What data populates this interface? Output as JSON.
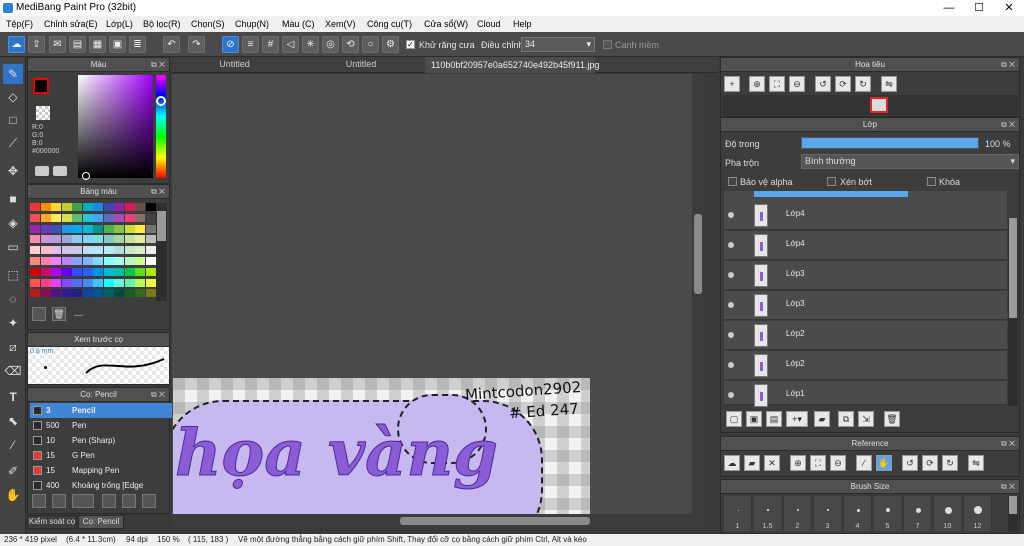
{
  "app": {
    "title": "MediBang Paint Pro (32bit)"
  },
  "menu": [
    "Tệp(F)",
    "Chỉnh sửa(E)",
    "Lớp(L)",
    "Bộ lọc(R)",
    "Chọn(S)",
    "Chụp(N)",
    "Màu (C)",
    "Xem(V)",
    "Công cụ(T)",
    "Cửa sổ(W)",
    "Cloud",
    "Help"
  ],
  "toolbar": {
    "antialias_label": "Khử răng cưa",
    "adjust_label": "Điều chỉnh",
    "adjust_value": "34",
    "edge_label": "Cạnh mềm"
  },
  "color_panel": {
    "title": "Màu",
    "r": "R:0",
    "g": "G:0",
    "b": "B:0",
    "hex": "#000000"
  },
  "palette_panel": {
    "title": "Bảng màu",
    "footer_text": "---"
  },
  "preview_panel": {
    "title": "Xem trước cọ",
    "size": "0.8 mm"
  },
  "brush_panel": {
    "title": "Cọ: Pencil",
    "items": [
      {
        "size": "3",
        "name": "Pencil",
        "color": "#2a2a2a"
      },
      {
        "size": "500",
        "name": "Pen",
        "color": "#2a2a2a"
      },
      {
        "size": "10",
        "name": "Pen (Sharp)",
        "color": "#2a2a2a"
      },
      {
        "size": "15",
        "name": "G Pen",
        "color": "#e53935"
      },
      {
        "size": "15",
        "name": "Mapping Pen",
        "color": "#e53935"
      },
      {
        "size": "400",
        "name": "Khoảng trống [Edge",
        "color": "#2a2a2a"
      }
    ]
  },
  "bottom_tabs": [
    "Kiểm soát cọ",
    "Cọ: Pencil"
  ],
  "doc_tabs": [
    "Untitled",
    "Untitled",
    "110b0bf20957e0a652740e492b45f911.jpg"
  ],
  "canvas": {
    "text1": "Mintcodon2902",
    "text2": "# Ed 247",
    "text3": "họa vàng"
  },
  "navigator": {
    "title": "Hoa tiêu"
  },
  "layer_panel": {
    "title": "Lớp",
    "opacity_label": "Độ trong",
    "opacity_value": "100 %",
    "opacity": 1.0,
    "blend_label": "Pha trộn",
    "blend_value": "Bình thường",
    "protect_alpha": "Bảo vệ alpha",
    "clipping": "Xén bớt",
    "lock": "Khóa",
    "layers": [
      "Lớp4",
      "Lớp4",
      "Lớp3",
      "Lớp3",
      "Lớp2",
      "Lớp2",
      "Lớp1"
    ]
  },
  "reference_panel": {
    "title": "Reference"
  },
  "brush_size_panel": {
    "title": "Brush Size",
    "sizes": [
      "1",
      "1.5",
      "2",
      "3",
      "4",
      "5",
      "7",
      "10",
      "12"
    ]
  },
  "status": {
    "dims": "236 * 419 pixel",
    "size": "(6.4 * 11.3cm)",
    "dpi": "94 dpi",
    "zoom": "150 %",
    "coords": "( 115, 183 )",
    "hint": "Vẽ một đường thẳng bằng cách giữ phím Shift, Thay đổi cỡ cọ bằng cách giữ phím Ctrl, Alt và kéo"
  },
  "colors": {
    "accent": "#2f74c9",
    "purple": "#8a5cd6",
    "lavender": "#c8b8f0"
  }
}
